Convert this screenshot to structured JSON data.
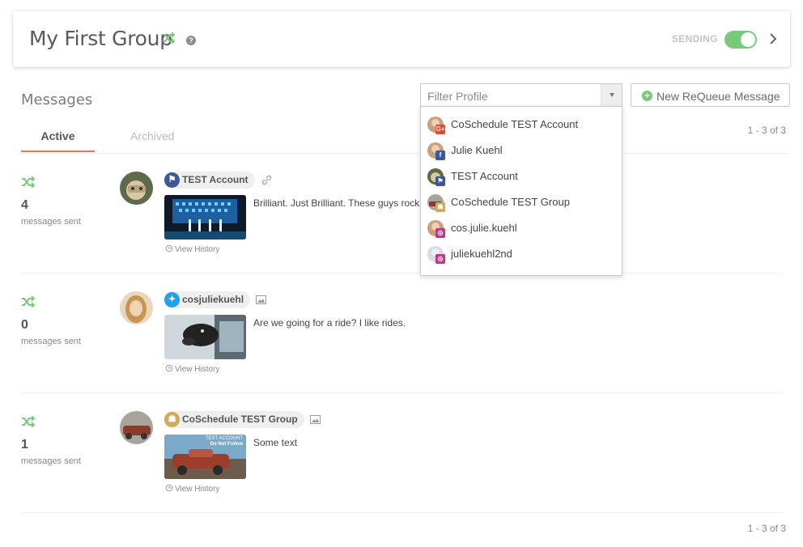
{
  "header": {
    "group_title": "My First Group",
    "help_glyph": "?",
    "sending_label": "SENDING",
    "sending_enabled": true,
    "accent_green": "#79c97a"
  },
  "messages_section": {
    "title": "Messages",
    "filter": {
      "placeholder": "Filter Profile"
    },
    "new_button_label": "New ReQueue Message",
    "tabs": [
      {
        "label": "Active",
        "selected": true
      },
      {
        "label": "Archived",
        "selected": false
      }
    ],
    "pager_top": "1 - 3 of 3",
    "pager_bottom": "1 - 3 of 3"
  },
  "rows": [
    {
      "count": "4",
      "sent_label": "messages sent",
      "profile_name": "TEST Account",
      "network": "facebook-page",
      "network_color": "#3b5998",
      "extra_icon": "link-icon",
      "text": "Brilliant. Just Brilliant. These guys rock",
      "history_label": "View History"
    },
    {
      "count": "0",
      "sent_label": "messages sent",
      "profile_name": "cosjuliekuehl",
      "network": "twitter",
      "network_color": "#1da1f2",
      "extra_icon": "image-icon",
      "text": "Are we going for a ride? I like rides.",
      "history_label": "View History"
    },
    {
      "count": "1",
      "sent_label": "messages sent",
      "profile_name": "CoSchedule TEST Group",
      "network": "facebook-group",
      "network_color": "#d4a95a",
      "extra_icon": "image-icon",
      "text": "Some text",
      "thumb_caption_1": "TEST ACCOUNT",
      "thumb_caption_2": "Do Not Follow",
      "history_label": "View History"
    }
  ],
  "dropdown": {
    "items": [
      {
        "label": "CoSchedule TEST Account",
        "network": "google-plus",
        "badge": "G+",
        "badge_color": "#dd4b39"
      },
      {
        "label": "Julie Kuehl",
        "network": "facebook",
        "badge": "f",
        "badge_color": "#3b5998"
      },
      {
        "label": "TEST Account",
        "network": "facebook-page",
        "badge": "⚑",
        "badge_color": "#3b5998"
      },
      {
        "label": "CoSchedule TEST Group",
        "network": "facebook-group",
        "badge": "☗",
        "badge_color": "#d4a95a"
      },
      {
        "label": "cos.julie.kuehl",
        "network": "instagram",
        "badge": "◎",
        "badge_color": "#c13584"
      },
      {
        "label": "juliekuehl2nd",
        "network": "instagram",
        "badge": "◎",
        "badge_color": "#c13584"
      }
    ]
  }
}
